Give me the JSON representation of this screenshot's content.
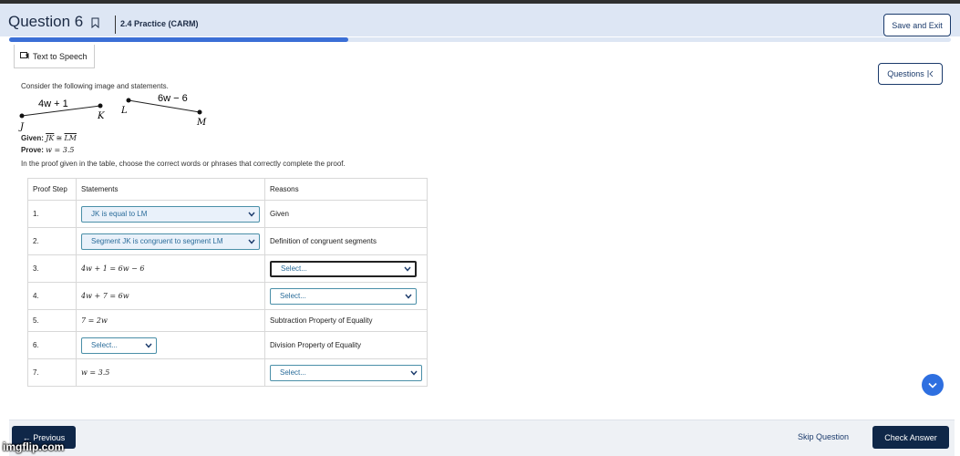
{
  "header": {
    "question_label": "Question 6",
    "assignment_title": "2.4 Practice (CARM)",
    "save_exit_label": "Save and Exit",
    "progress_fraction": 0.36
  },
  "toolbar": {
    "tts_label": "Text to Speech",
    "questions_label": "Questions"
  },
  "content": {
    "intro": "Consider the following image and statements.",
    "figure": {
      "label_jk": "4w + 1",
      "label_lm": "6w − 6",
      "point_j": "J",
      "point_k": "K",
      "point_l": "L",
      "point_m": "M"
    },
    "given_prefix": "Given:",
    "given_seg1": "JK",
    "given_rel": " ≅ ",
    "given_seg2": "LM",
    "prove_prefix": "Prove:",
    "prove_expr": "w = 3.5",
    "instructions": "In the proof given in the table, choose the correct words or phrases that correctly complete the proof."
  },
  "table": {
    "headers": [
      "Proof Step",
      "Statements",
      "Reasons"
    ],
    "rows": [
      {
        "step": "1.",
        "statement": "JK is equal to LM",
        "reason": "Given"
      },
      {
        "step": "2.",
        "statement": "Segment JK is congruent to segment LM",
        "reason": "Definition of congruent segments"
      },
      {
        "step": "3.",
        "statement": "4w + 1 = 6w − 6",
        "reason": "Select..."
      },
      {
        "step": "4.",
        "statement": "4w + 7 = 6w",
        "reason": "Select..."
      },
      {
        "step": "5.",
        "statement": "7 = 2w",
        "reason": "Subtraction Property of Equality"
      },
      {
        "step": "6.",
        "statement": "Select...",
        "reason": "Division Property of Equality"
      },
      {
        "step": "7.",
        "statement": "w = 3.5",
        "reason": "Select..."
      }
    ]
  },
  "footer": {
    "previous_label": "← Previous",
    "skip_label": "Skip Question",
    "check_label": "Check Answer"
  },
  "watermark": "imgflip.com",
  "colors": {
    "header_bg": "#dde6f4",
    "progress": "#3b6fd6",
    "navy": "#0f2748",
    "select_border": "#4a8fa8",
    "scroll_btn": "#2e6fe0"
  }
}
